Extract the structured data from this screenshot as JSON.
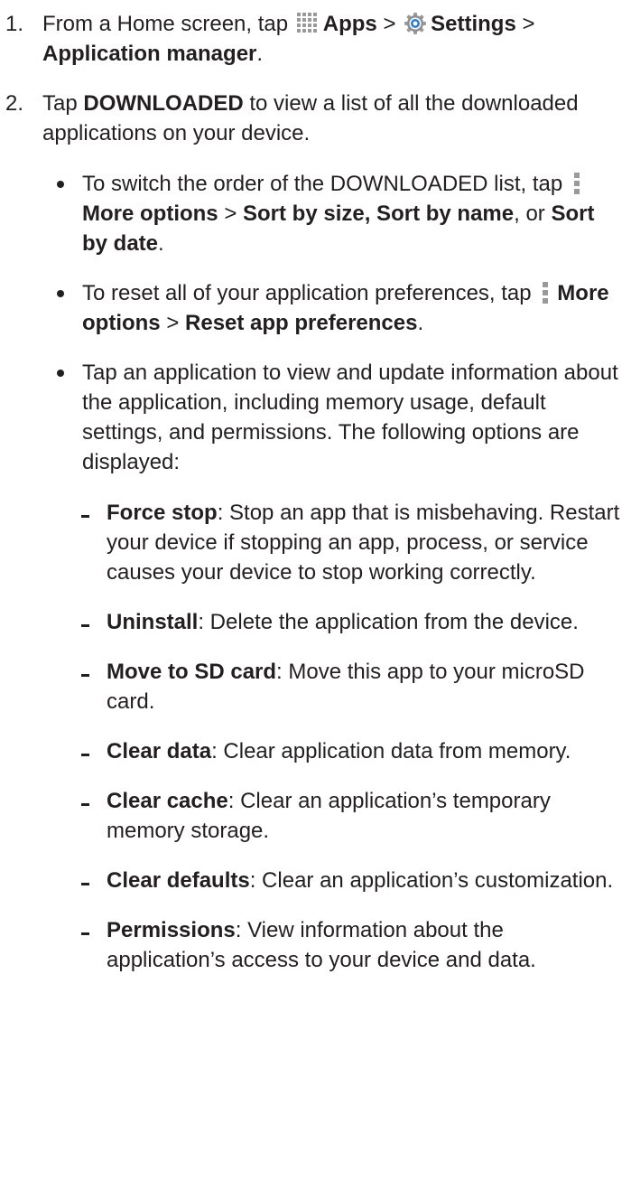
{
  "steps": [
    {
      "num": "1.",
      "pre": "From a Home screen, tap",
      "apps_icon": "apps-grid-icon",
      "apps_label": "Apps",
      "sep1": ">",
      "settings_icon": "settings-gear-icon",
      "settings_label": "Settings",
      "sep2": ">",
      "app_manager_label": "Application manager",
      "end": "."
    },
    {
      "num": "2.",
      "pre": "Tap",
      "downloaded_label": "DOWNLOADED",
      "post": "to view a list of all the downloaded applications on your device."
    }
  ],
  "bullets": [
    {
      "pre": "To switch the order of the DOWNLOADED list, tap",
      "more_icon": "more-options-icon",
      "more_label": "More options",
      "sep": ">",
      "sort_label": "Sort by size, Sort by name",
      "mid": ", or",
      "sort_date_label": "Sort by date",
      "end": "."
    },
    {
      "pre": "To reset all of your application preferences, tap",
      "more_icon": "more-options-icon",
      "more_label": "More options",
      "sep": ">",
      "reset_label": "Reset app preferences",
      "end": "."
    },
    {
      "text": "Tap an application to view and update information about the application, including memory usage, default settings, and permissions. The following options are displayed:"
    }
  ],
  "options": [
    {
      "term": "Force stop",
      "desc": ": Stop an app that is misbehaving. Restart your device if stopping an app, process, or service causes your device to stop working correctly."
    },
    {
      "term": "Uninstall",
      "desc": ": Delete the application from the device."
    },
    {
      "term": "Move to SD card",
      "desc": ": Move this app to your microSD card."
    },
    {
      "term": "Clear data",
      "desc": ": Clear application data from memory."
    },
    {
      "term": "Clear cache",
      "desc": ": Clear an application’s temporary memory storage."
    },
    {
      "term": "Clear defaults",
      "desc": ": Clear an application’s customization."
    },
    {
      "term": "Permissions",
      "desc": ": View information about the application’s access to your device and data."
    }
  ],
  "colors": {
    "text": "#231f20",
    "icon_gray": "#9a9a9a",
    "settings_blue": "#2a7fd4"
  }
}
